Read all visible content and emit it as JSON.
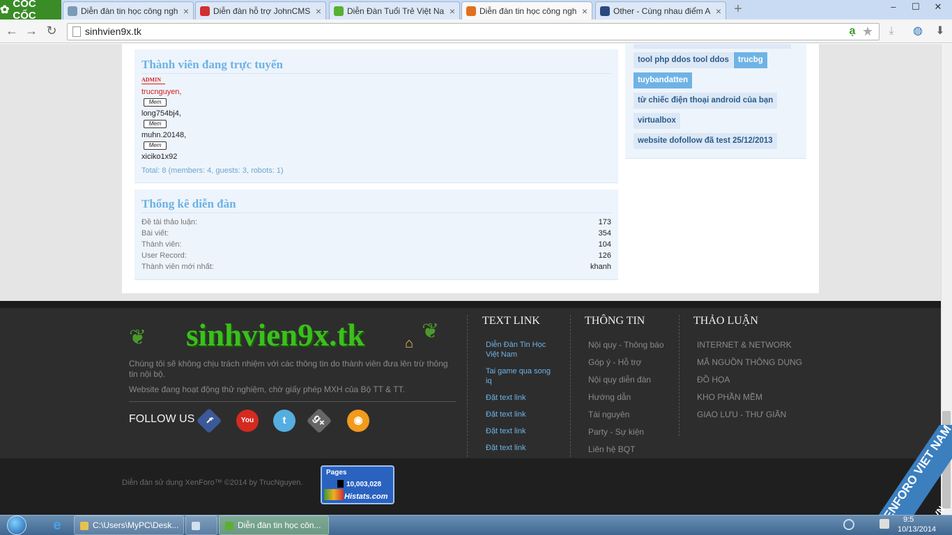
{
  "browser": {
    "logo": "CỐC CỐC",
    "tabs": [
      {
        "title": "Diễn đàn tin học công ngh",
        "favicon_color": "#7a9bb8"
      },
      {
        "title": "Diễn đàn hỗ trợ JohnCMS \\",
        "favicon_color": "#d03030"
      },
      {
        "title": "Diễn Đàn Tuổi Trẻ Việt Na",
        "favicon_color": "#58b030"
      },
      {
        "title": "Diễn đàn tin học công ngh",
        "favicon_color": "#e07020"
      },
      {
        "title": "Other - Cùng nhau điểm A",
        "favicon_color": "#2a4a80"
      }
    ],
    "url": "sinhvien9x.tk"
  },
  "online": {
    "title": "Thành viên đang trực tuyến",
    "admin_badge": "ADMIN",
    "members": [
      {
        "name": "trucnguyen,",
        "badge": "Mem",
        "color": "#d41e1e"
      },
      {
        "name": "long754bj4,",
        "badge": "Mem",
        "color": "#222222"
      },
      {
        "name": "muhn.20148,",
        "badge": "Mem",
        "color": "#222222"
      },
      {
        "name": "xiciko1x92",
        "badge": "",
        "color": "#222222"
      }
    ],
    "total": "Total: 8 (members: 4, guests: 3, robots: 1)"
  },
  "stats": {
    "title": "Thống kê diễn đàn",
    "rows": [
      {
        "label": "Đề tài thảo luận:",
        "value": "173"
      },
      {
        "label": "Bài viết:",
        "value": "354"
      },
      {
        "label": "Thành viên:",
        "value": "104"
      },
      {
        "label": "User Record:",
        "value": "126"
      },
      {
        "label": "Thành viên mới nhất:",
        "value": "khanh"
      }
    ]
  },
  "tags": [
    {
      "text": "tool php ddos tool ddos",
      "style": "light"
    },
    {
      "text": "trucbg",
      "style": "dark"
    },
    {
      "text": "tuybandatten",
      "style": "dark"
    },
    {
      "text": "từ chiếc điện thoại android của bạn",
      "style": "light"
    },
    {
      "text": "virtualbox",
      "style": "light"
    },
    {
      "text": "website dofollow đã test 25/12/2013",
      "style": "light"
    }
  ],
  "footer": {
    "site_logo": "sinhvien9x.tk",
    "disclaimer": "Chúng tôi sẽ không chịu trách nhiệm với các thông tin do thành viên đưa lên trừ thông tin nội bộ.",
    "license": "Website đang hoạt động thử nghiệm, chờ giấy phép MXH của Bộ TT & TT.",
    "follow_us": "FOLLOW US",
    "social": [
      {
        "name": "facebook",
        "glyph": "f",
        "color": "#3b5998"
      },
      {
        "name": "youtube",
        "glyph": "You",
        "color": "#d42a20"
      },
      {
        "name": "twitter",
        "glyph": "t",
        "color": "#55aee0"
      },
      {
        "name": "googleplus",
        "glyph": "g+",
        "color": "#666666"
      },
      {
        "name": "rss",
        "glyph": "◉",
        "color": "#f29a1c"
      }
    ],
    "text_link": {
      "title": "TEXT LINK",
      "items": [
        "Diễn Đàn Tin Học Việt Nam",
        "Tai game qua song iq",
        "Đặt text link",
        "Đặt text link",
        "Đặt text link",
        "Đặt text link"
      ]
    },
    "thong_tin": {
      "title": "THÔNG TIN",
      "items": [
        "Nội quy - Thông báo",
        "Góp ý - Hỗ trợ",
        "Nội quy diễn đàn",
        "Hướng dẫn",
        "Tài nguyên",
        "Party - Sự kiện",
        "Liên hệ BQT"
      ]
    },
    "thao_luan": {
      "title": "THẢO LUẬN",
      "items": [
        "INTERNET & NETWORK",
        "MÃ NGUỒN THÔNG DỤNG",
        "ĐỒ HỌA",
        "KHO PHẦN MỀM",
        "GIAO LƯU - THƯ GIÃN"
      ]
    },
    "copyright": "Diễn đàn sử dụng XenForo™ ©2014 by TrucNguyen.",
    "histats_pages_label": "Pages",
    "histats_count": "10,003,028",
    "histats_brand": "Histats.com"
  },
  "watermark": "XENFORO VIET NAM",
  "watermark_url": "XFVF.VN",
  "taskbar": {
    "items": [
      {
        "label": "C:\\Users\\MyPC\\Desk...",
        "icon": "folder-icon"
      },
      {
        "label": "",
        "icon": "notepad-icon"
      },
      {
        "label": "Diễn đàn tin học côn...",
        "icon": "coccoc-icon"
      }
    ],
    "time": "9:5",
    "date": "10/13/2014"
  }
}
